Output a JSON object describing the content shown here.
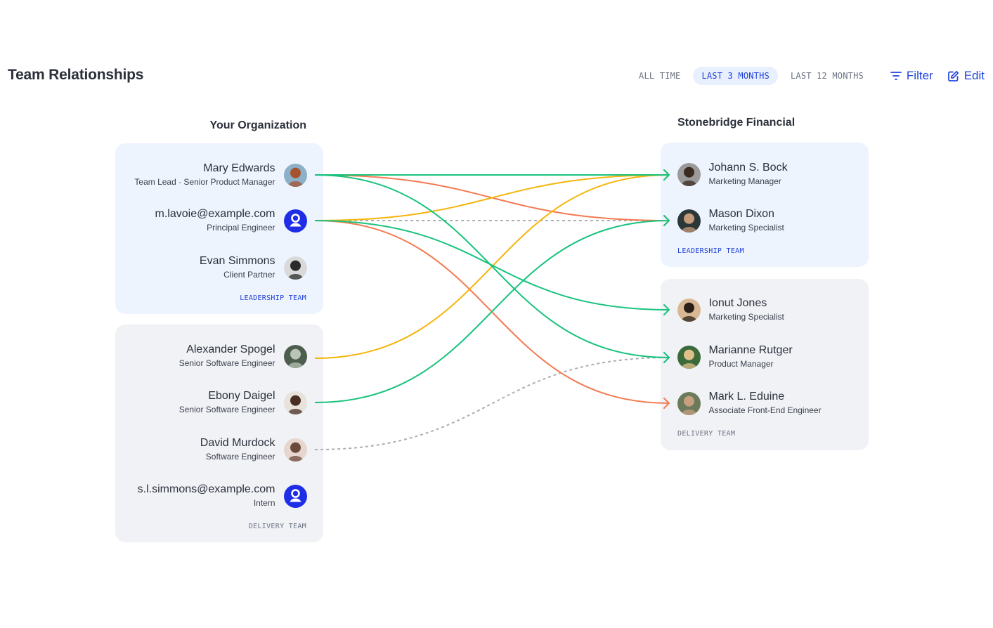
{
  "header": {
    "title": "Team Relationships",
    "ranges": [
      {
        "label": "ALL TIME",
        "active": false
      },
      {
        "label": "LAST 3 MONTHS",
        "active": true
      },
      {
        "label": "LAST 12 MONTHS",
        "active": false
      }
    ],
    "filter_label": "Filter",
    "edit_label": "Edit"
  },
  "colors": {
    "accent": "#1f45e0",
    "green": "#19c37d",
    "orange": "#f47a52",
    "yellow": "#f5b50d",
    "dashed": "#a9adb6"
  },
  "left": {
    "title": "Your Organization",
    "teams": [
      {
        "id": "lead",
        "label": "LEADERSHIP TEAM",
        "people": [
          {
            "id": "mary",
            "name": "Mary Edwards",
            "role": "Team Lead · Senior Product Manager",
            "avatar": "photo",
            "tone": [
              "#8bb0c8",
              "#a5532f"
            ]
          },
          {
            "id": "lavoie",
            "name": "m.lavoie@example.com",
            "role": "Principal Engineer",
            "avatar": "generic"
          },
          {
            "id": "evan",
            "name": "Evan Simmons",
            "role": "Client Partner",
            "avatar": "photo",
            "tone": [
              "#d9d9d9",
              "#2a2a2a"
            ]
          }
        ]
      },
      {
        "id": "delivery",
        "label": "DELIVERY TEAM",
        "people": [
          {
            "id": "alexander",
            "name": "Alexander Spogel",
            "role": "Senior Software Engineer",
            "avatar": "photo",
            "tone": [
              "#4d5e4e",
              "#b7c4b6"
            ]
          },
          {
            "id": "ebony",
            "name": "Ebony Daigel",
            "role": "Senior Software Engineer",
            "avatar": "photo",
            "tone": [
              "#e7e2da",
              "#4a2e22"
            ]
          },
          {
            "id": "david",
            "name": "David Murdock",
            "role": "Software Engineer",
            "avatar": "photo",
            "tone": [
              "#e6d6cf",
              "#6b4a3b"
            ]
          },
          {
            "id": "slsimmons",
            "name": "s.l.simmons@example.com",
            "role": "Intern",
            "avatar": "generic"
          }
        ]
      }
    ]
  },
  "right": {
    "title": "Stonebridge Financial",
    "teams": [
      {
        "id": "lead",
        "label": "LEADERSHIP TEAM",
        "people": [
          {
            "id": "johann",
            "name": "Johann S. Bock",
            "role": "Marketing Manager",
            "avatar": "photo",
            "tone": [
              "#9a9a9a",
              "#3a2a20"
            ]
          },
          {
            "id": "mason",
            "name": "Mason Dixon",
            "role": "Marketing Specialist",
            "avatar": "photo",
            "tone": [
              "#2c3838",
              "#c79a7a"
            ]
          }
        ]
      },
      {
        "id": "delivery",
        "label": "DELIVERY TEAM",
        "people": [
          {
            "id": "ionut",
            "name": "Ionut Jones",
            "role": "Marketing Specialist",
            "avatar": "photo",
            "tone": [
              "#d8b894",
              "#2a1f18"
            ]
          },
          {
            "id": "marianne",
            "name": "Marianne Rutger",
            "role": "Product Manager",
            "avatar": "photo",
            "tone": [
              "#3c6a3a",
              "#e0c089"
            ]
          },
          {
            "id": "mark",
            "name": "Mark L. Eduine",
            "role": "Associate Front-End Engineer",
            "avatar": "photo",
            "tone": [
              "#6a7a5a",
              "#c8a080"
            ]
          }
        ]
      }
    ]
  },
  "links": [
    {
      "from": "mary",
      "to": "johann",
      "color": "green",
      "dashed": false
    },
    {
      "from": "mary",
      "to": "mason",
      "color": "orange",
      "dashed": false
    },
    {
      "from": "mary",
      "to": "marianne",
      "color": "green",
      "dashed": false
    },
    {
      "from": "lavoie",
      "to": "johann",
      "color": "yellow",
      "dashed": false
    },
    {
      "from": "lavoie",
      "to": "mason",
      "color": "dashed",
      "dashed": true
    },
    {
      "from": "lavoie",
      "to": "ionut",
      "color": "green",
      "dashed": false
    },
    {
      "from": "lavoie",
      "to": "mark",
      "color": "orange",
      "dashed": false
    },
    {
      "from": "alexander",
      "to": "johann",
      "color": "yellow",
      "dashed": false
    },
    {
      "from": "ebony",
      "to": "mason",
      "color": "green",
      "dashed": false
    },
    {
      "from": "david",
      "to": "marianne",
      "color": "dashed",
      "dashed": true
    }
  ]
}
